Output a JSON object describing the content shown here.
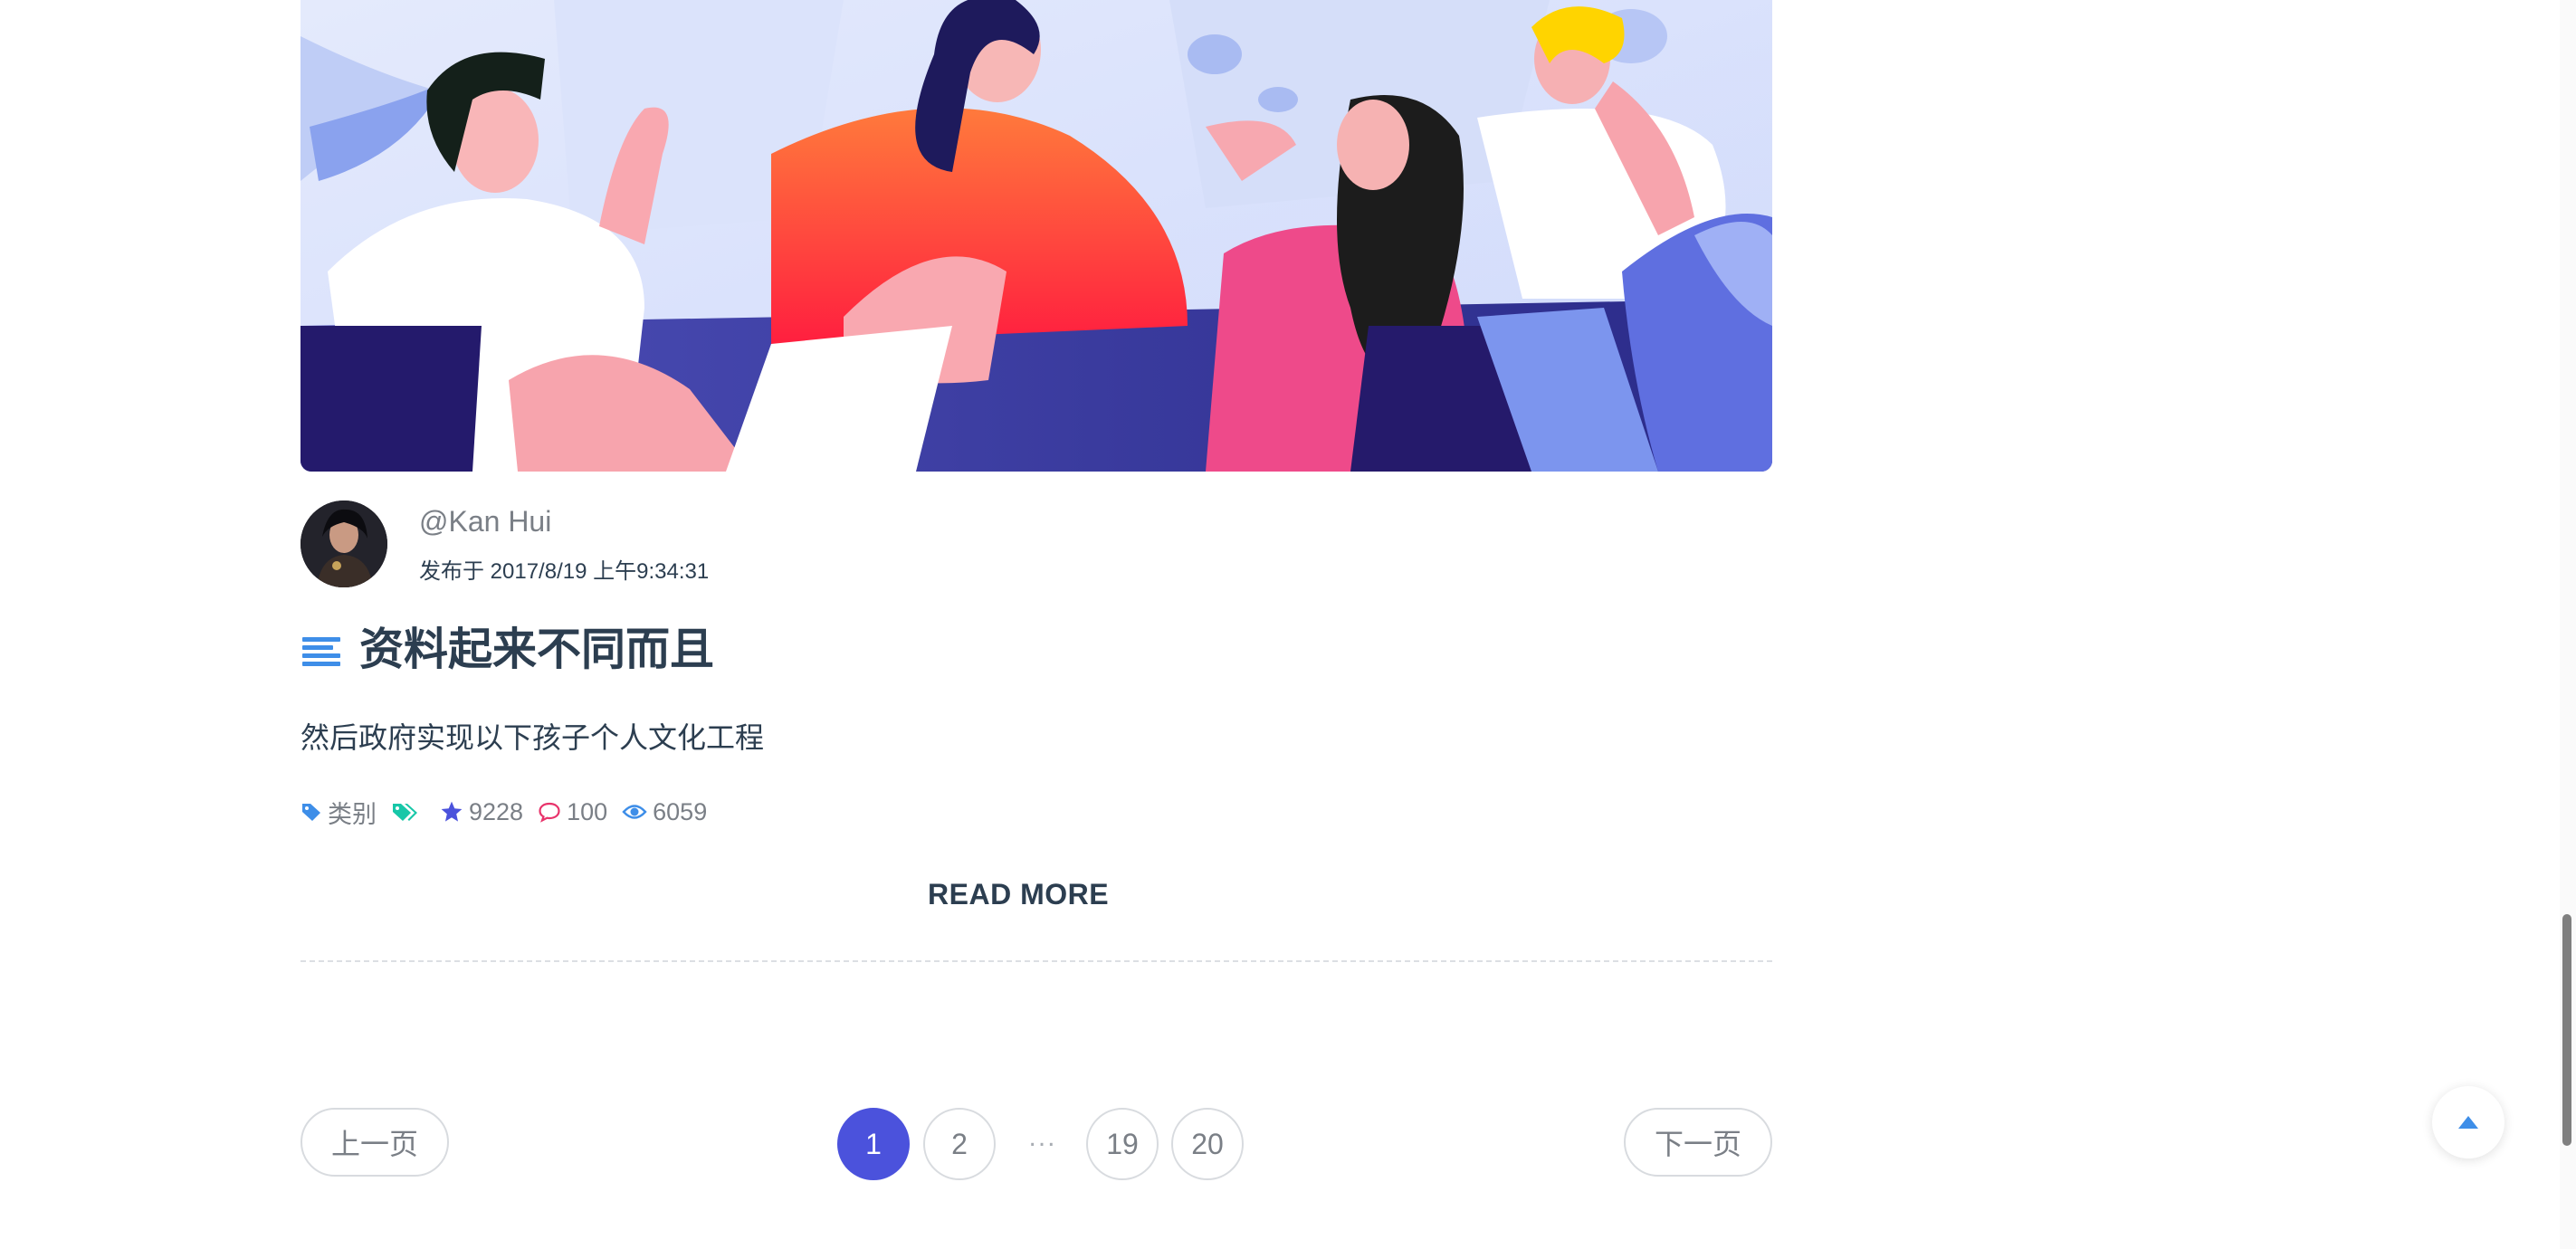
{
  "post": {
    "image": "illustration-team-meeting",
    "author_name": "@Kan Hui",
    "published": "发布于 2017/8/19 上午9:34:31",
    "title": "资料起来不同而且",
    "excerpt": "然后政府实现以下孩子个人文化工程",
    "meta": {
      "category": "类别",
      "stars": "9228",
      "comments": "100",
      "views": "6059"
    },
    "read_more": "READ MORE"
  },
  "pagination": {
    "prev": "上一页",
    "next": "下一页",
    "pages": [
      "1",
      "2",
      "19",
      "20"
    ],
    "ellipsis": "...",
    "current": "1"
  },
  "colors": {
    "accent": "#4b52dc",
    "text": "#2c3e50",
    "muted": "#7a7f86",
    "icon_blue": "#3e8ee8",
    "icon_teal": "#17c7a8",
    "icon_pink": "#e8336b"
  },
  "icons": [
    "tag-icon",
    "tags-icon",
    "star-icon",
    "comment-icon",
    "eye-icon",
    "caret-up-icon",
    "list-icon"
  ]
}
